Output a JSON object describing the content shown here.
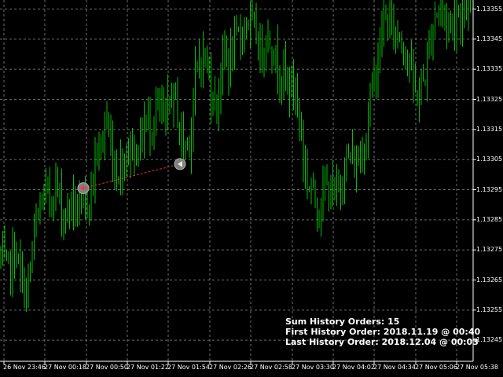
{
  "colors": {
    "background": "#000000",
    "bar_up": "#00c000",
    "grid": "#6e6e6e",
    "axis": "#ffffff",
    "text": "#ffffff",
    "order_line": "#e03030",
    "marker_fill": "#808080",
    "buy_marker": "#ff3030",
    "sell_marker": "#e8e8e8"
  },
  "chart_data": {
    "type": "line",
    "symbol_style": "bars",
    "price_axis": {
      "ticks": [
        "1.13355",
        "1.13345",
        "1.13335",
        "1.13325",
        "1.13315",
        "1.13305",
        "1.13295",
        "1.13285",
        "1.13275",
        "1.13265",
        "1.13255",
        "1.13245"
      ],
      "ylim": [
        1.13238,
        1.13358
      ]
    },
    "time_axis": {
      "ticks": [
        "26 Nov 23:46",
        "27 Nov 00:18",
        "27 Nov 00:50",
        "27 Nov 01:22",
        "27 Nov 01:54",
        "27 Nov 02:26",
        "27 Nov 02:58",
        "27 Nov 03:30",
        "27 Nov 04:02",
        "27 Nov 04:34",
        "27 Nov 05:06",
        "27 Nov 05:38"
      ]
    },
    "series": [
      {
        "values": [
          1.13273,
          1.13268,
          1.1327,
          1.13275,
          1.13265,
          1.1326,
          1.1327,
          1.13283,
          1.1329,
          1.13294,
          1.13292,
          1.13298,
          1.1329,
          1.13286,
          1.13292,
          1.13289,
          1.13287,
          1.1329,
          1.13295,
          1.13305,
          1.1331,
          1.13318,
          1.1331,
          1.133,
          1.13303,
          1.13307,
          1.1331,
          1.13307,
          1.13312,
          1.13318,
          1.13316,
          1.13322,
          1.1332,
          1.13317,
          1.13327,
          1.13325,
          1.13312,
          1.1331,
          1.13314,
          1.13332,
          1.1334,
          1.13338,
          1.1333,
          1.13322,
          1.13334,
          1.1334,
          1.13337,
          1.13344,
          1.13346,
          1.13352,
          1.1335,
          1.13347,
          1.1334,
          1.13346,
          1.13345,
          1.13338,
          1.13335,
          1.13332,
          1.1333,
          1.13328,
          1.13316,
          1.133,
          1.13296,
          1.13292,
          1.1329,
          1.13296,
          1.13295,
          1.13292,
          1.13298,
          1.13304,
          1.13306,
          1.13302,
          1.13307,
          1.13312,
          1.13326,
          1.13334,
          1.13345,
          1.13352,
          1.1335,
          1.13348,
          1.13346,
          1.13342,
          1.13336,
          1.13326,
          1.13328,
          1.13334,
          1.13345,
          1.13354,
          1.13356,
          1.13352,
          1.1335,
          1.13353,
          1.13354,
          1.13356,
          1.13352
        ],
        "x_spacing_note": ""
      }
    ],
    "orders": [
      {
        "type": "buy",
        "open_price": 1.132955,
        "close_price": 1.133035
      }
    ]
  },
  "info": {
    "sum_orders": "Sum History Orders: 15",
    "first_order": "First History Order: 2018.11.19 @ 00:40",
    "last_order": "Last History Order: 2018.12.04 @ 00:03"
  }
}
